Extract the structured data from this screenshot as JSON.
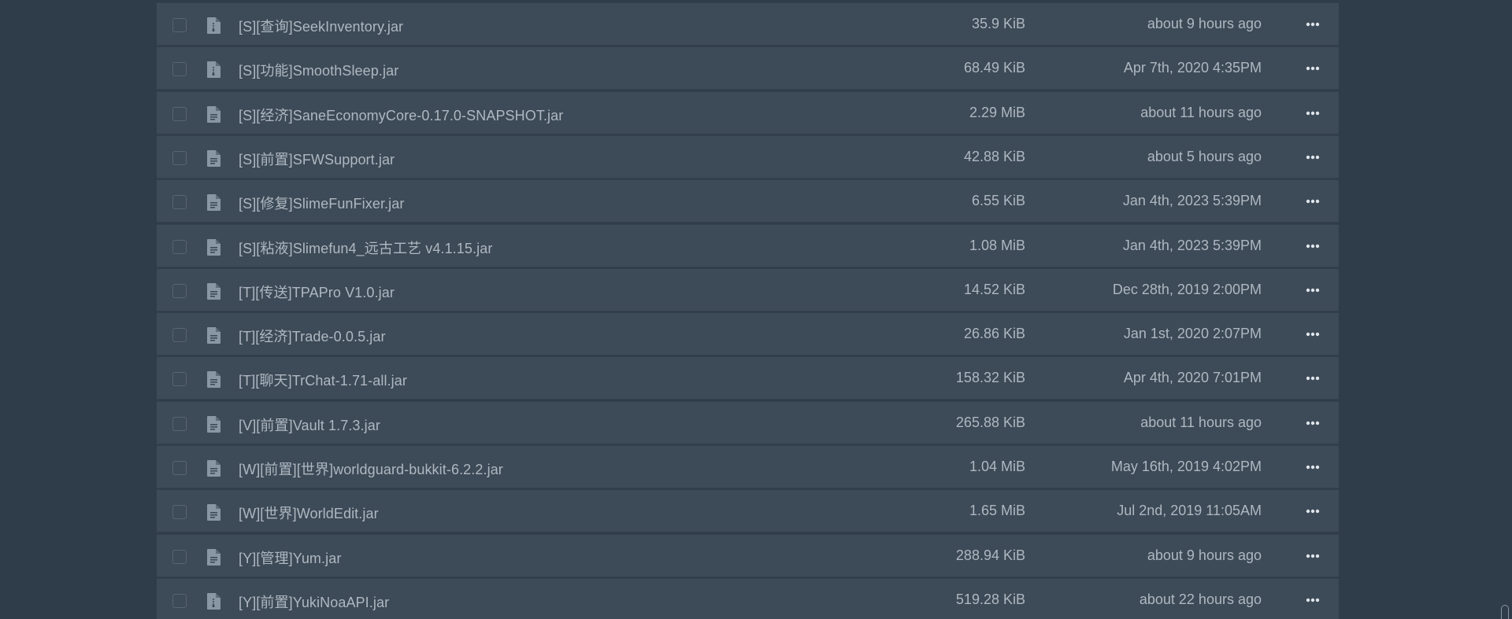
{
  "files": [
    {
      "name": "[S][查询]SeekInventory.jar",
      "size": "35.9 KiB",
      "modified": "about 9 hours ago",
      "icon": "file-code-icon"
    },
    {
      "name": "[S][功能]SmoothSleep.jar",
      "size": "68.49 KiB",
      "modified": "Apr 7th, 2020 4:35PM",
      "icon": "file-code-icon"
    },
    {
      "name": "[S][经济]SaneEconomyCore-0.17.0-SNAPSHOT.jar",
      "size": "2.29 MiB",
      "modified": "about 11 hours ago",
      "icon": "file-text-icon"
    },
    {
      "name": "[S][前置]SFWSupport.jar",
      "size": "42.88 KiB",
      "modified": "about 5 hours ago",
      "icon": "file-text-icon"
    },
    {
      "name": "[S][修复]SlimeFunFixer.jar",
      "size": "6.55 KiB",
      "modified": "Jan 4th, 2023 5:39PM",
      "icon": "file-text-icon"
    },
    {
      "name": "[S][粘液]Slimefun4_远古工艺 v4.1.15.jar",
      "size": "1.08 MiB",
      "modified": "Jan 4th, 2023 5:39PM",
      "icon": "file-text-icon"
    },
    {
      "name": "[T][传送]TPAPro V1.0.jar",
      "size": "14.52 KiB",
      "modified": "Dec 28th, 2019 2:00PM",
      "icon": "file-text-icon"
    },
    {
      "name": "[T][经济]Trade-0.0.5.jar",
      "size": "26.86 KiB",
      "modified": "Jan 1st, 2020 2:07PM",
      "icon": "file-text-icon"
    },
    {
      "name": "[T][聊天]TrChat-1.71-all.jar",
      "size": "158.32 KiB",
      "modified": "Apr 4th, 2020 7:01PM",
      "icon": "file-text-icon"
    },
    {
      "name": "[V][前置]Vault 1.7.3.jar",
      "size": "265.88 KiB",
      "modified": "about 11 hours ago",
      "icon": "file-text-icon"
    },
    {
      "name": "[W][前置][世界]worldguard-bukkit-6.2.2.jar",
      "size": "1.04 MiB",
      "modified": "May 16th, 2019 4:02PM",
      "icon": "file-text-icon"
    },
    {
      "name": "[W][世界]WorldEdit.jar",
      "size": "1.65 MiB",
      "modified": "Jul 2nd, 2019 11:05AM",
      "icon": "file-text-icon"
    },
    {
      "name": "[Y][管理]Yum.jar",
      "size": "288.94 KiB",
      "modified": "about 9 hours ago",
      "icon": "file-text-icon"
    },
    {
      "name": "[Y][前置]YukiNoaAPI.jar",
      "size": "519.28 KiB",
      "modified": "about 22 hours ago",
      "icon": "file-code-icon"
    }
  ],
  "colors": {
    "page_background": "#2f3c49",
    "row_background": "#3d4a57",
    "row_border": "#34414d",
    "text": "#aeb8c2",
    "icon": "#8996a3"
  }
}
